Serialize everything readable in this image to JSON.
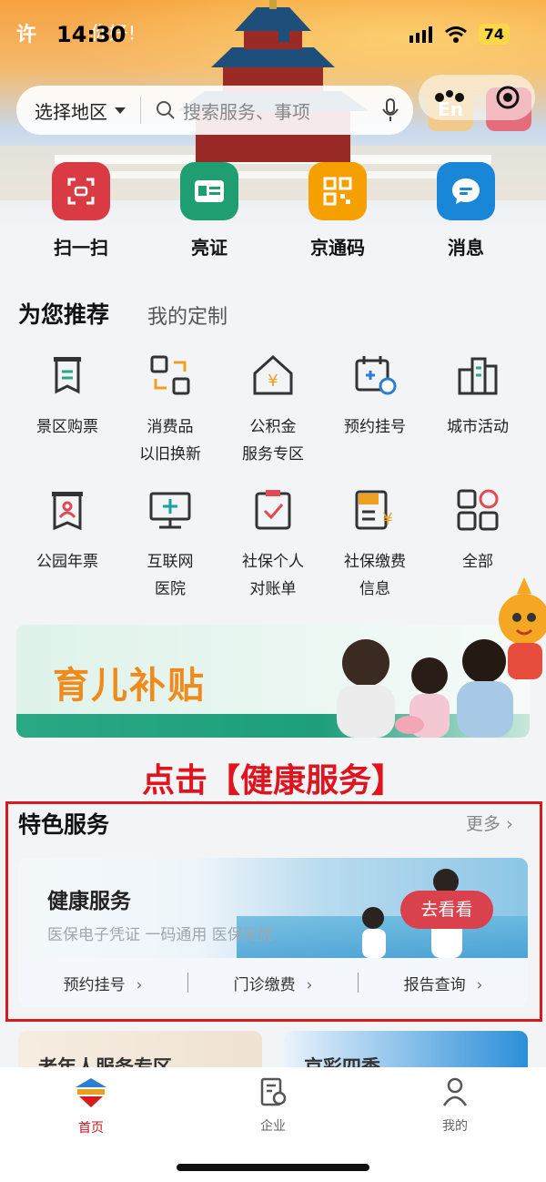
{
  "status": {
    "left": "许",
    "time": "14:30",
    "greeting": "你好！",
    "battery": "74"
  },
  "search": {
    "region": "选择地区",
    "placeholder": "搜索服务、事项"
  },
  "lang": "En",
  "quick_actions": [
    {
      "label": "扫一扫",
      "icon": "scan-icon",
      "color": "#d93a43"
    },
    {
      "label": "亮证",
      "icon": "id-card-icon",
      "color": "#1f9e71"
    },
    {
      "label": "京通码",
      "icon": "qr-code-icon",
      "color": "#f5a000"
    },
    {
      "label": "消息",
      "icon": "message-icon",
      "color": "#1a86d8"
    }
  ],
  "recommend": {
    "title": "为您推荐",
    "tab": "我的定制",
    "items": [
      {
        "label": "景区购票",
        "icon": "ticket-icon"
      },
      {
        "label": "消费品\n以旧换新",
        "icon": "trade-in-icon"
      },
      {
        "label": "公积金\n服务专区",
        "icon": "housing-fund-icon"
      },
      {
        "label": "预约挂号",
        "icon": "appointment-icon"
      },
      {
        "label": "城市活动",
        "icon": "city-icon"
      },
      {
        "label": "公园年票",
        "icon": "park-pass-icon"
      },
      {
        "label": "互联网\n医院",
        "icon": "online-hospital-icon"
      },
      {
        "label": "社保个人\n对账单",
        "icon": "statement-icon"
      },
      {
        "label": "社保缴费\n信息",
        "icon": "social-insurance-icon"
      },
      {
        "label": "全部",
        "icon": "all-apps-icon"
      }
    ]
  },
  "banner": {
    "text": "育儿补贴"
  },
  "instruction": "点击【健康服务】",
  "featured": {
    "title": "特色服务",
    "more": "更多",
    "card": {
      "title": "健康服务",
      "subtitle": "医保电子凭证 一码通用 医保无忧",
      "button": "去看看",
      "links": [
        "预约挂号",
        "门诊缴费",
        "报告查询"
      ]
    }
  },
  "peek_cards": [
    "老年人服务专区",
    "京彩四季"
  ],
  "tabbar": [
    {
      "label": "首页",
      "icon": "home-icon",
      "active": true
    },
    {
      "label": "企业",
      "icon": "enterprise-icon",
      "active": false
    },
    {
      "label": "我的",
      "icon": "profile-icon",
      "active": false
    }
  ],
  "colors": {
    "accent": "#d71920",
    "active_tab": "#c8161e"
  }
}
